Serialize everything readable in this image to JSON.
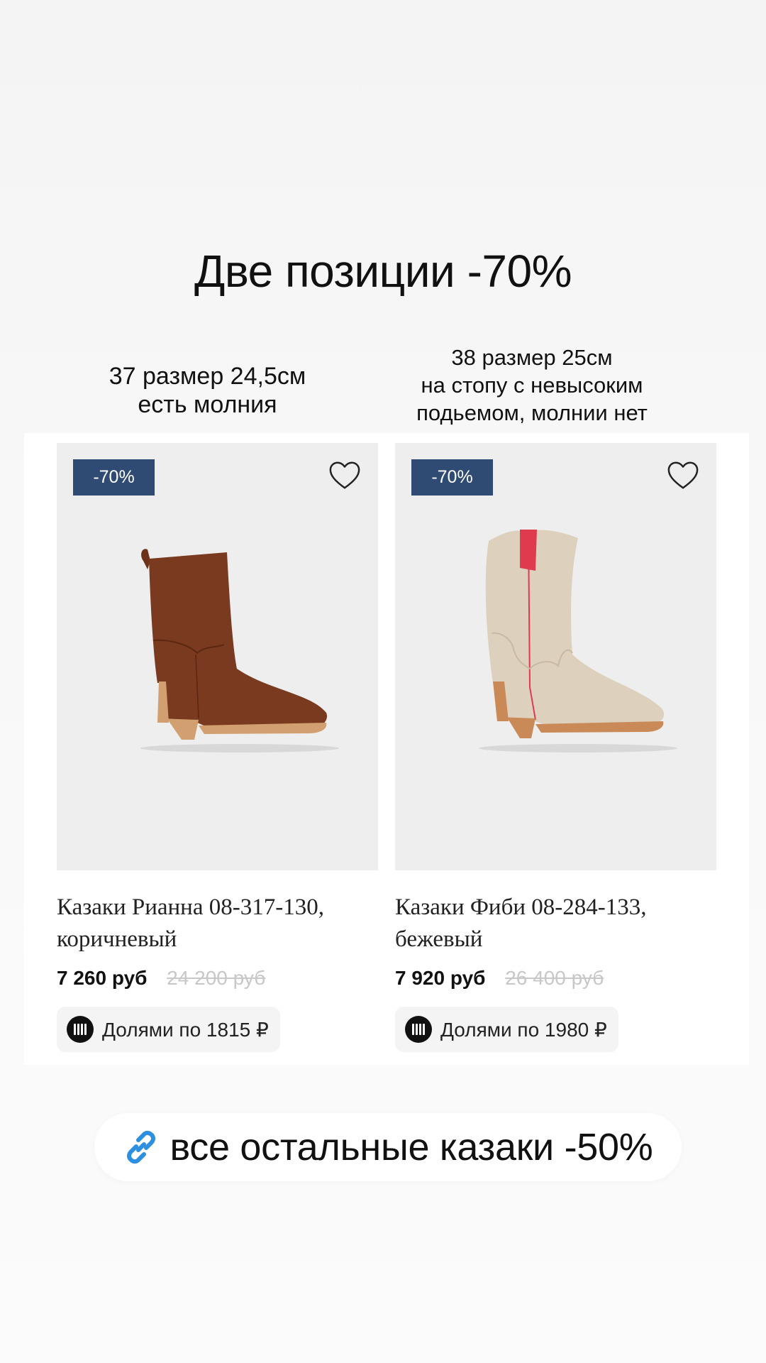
{
  "headline": "Две позиции -70%",
  "notes": {
    "left": [
      "37 размер 24,5см",
      "есть молния"
    ],
    "right": [
      "38 размер 25см",
      "на стопу с невысоким",
      "подьемом, молнии нет"
    ]
  },
  "products": [
    {
      "badge": "-70%",
      "title_lines": [
        "Казаки Рианна 08-317-130,",
        "коричневый"
      ],
      "price": "7 260 руб",
      "old_price": "24 200 руб",
      "installment": "Долями по 1815 ₽",
      "boot_color": "#7a3a1f",
      "accent_color": "#d2a070"
    },
    {
      "badge": "-70%",
      "title_lines": [
        "Казаки Фиби 08-284-133,",
        "бежевый"
      ],
      "price": "7 920 руб",
      "old_price": "26 400 руб",
      "installment": "Долями по 1980 ₽",
      "boot_color": "#ddd0bd",
      "accent_color": "#e03a4f"
    }
  ],
  "link": {
    "label": "все остальные казаки -50%",
    "icon": "link-icon",
    "icon_color": "#2c8fe0"
  },
  "colors": {
    "badge": "#2f4a73"
  }
}
